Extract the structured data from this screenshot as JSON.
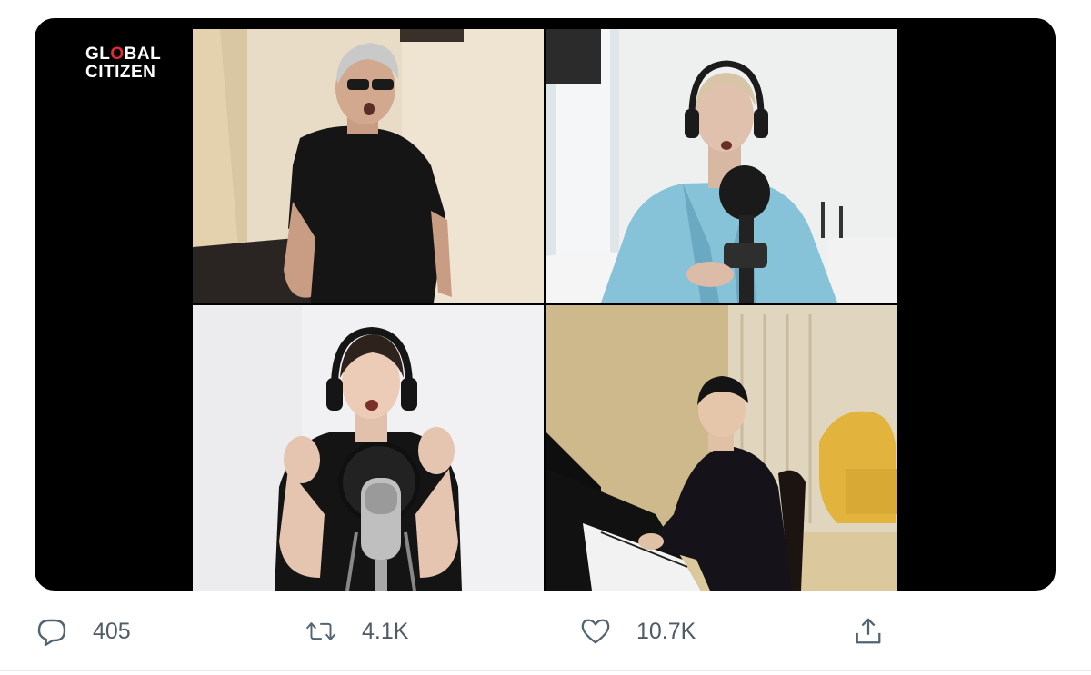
{
  "video": {
    "logo_line1_a": "GL",
    "logo_line1_o": "O",
    "logo_line1_b": "BAL",
    "logo_line2": "CITIZEN",
    "accent_red": "#e4293a",
    "background": "#000000"
  },
  "actions": {
    "reply": {
      "icon": "reply-bubble-icon",
      "count": "405"
    },
    "retweet": {
      "icon": "retweet-icon",
      "count": "4.1K"
    },
    "like": {
      "icon": "heart-icon",
      "count": "10.7K"
    },
    "share": {
      "icon": "share-upload-icon"
    }
  },
  "colors": {
    "action_gray": "#536471",
    "divider": "#e6ecf0"
  }
}
